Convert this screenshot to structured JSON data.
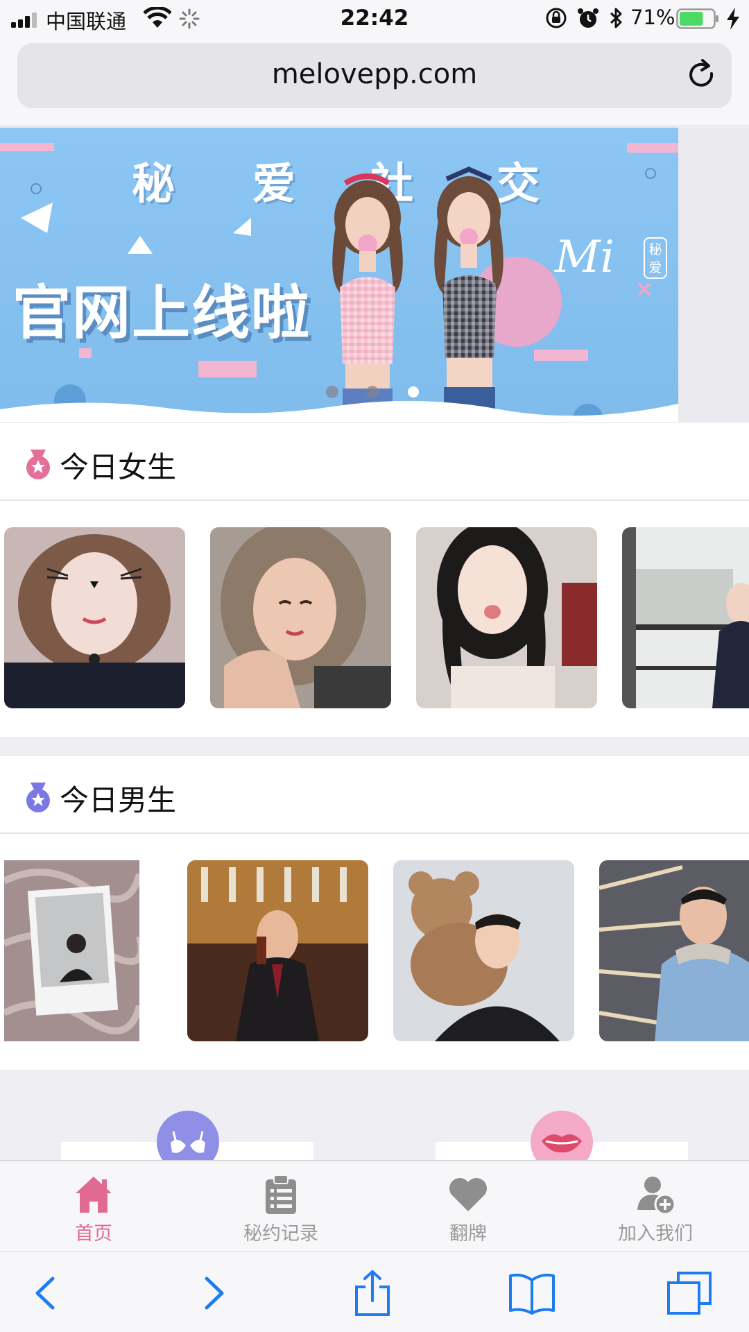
{
  "status_bar": {
    "carrier": "中国联通",
    "time": "22:42",
    "battery_percent": "71%",
    "battery_level": 0.71
  },
  "browser": {
    "url": "melovepp.com"
  },
  "banner": {
    "tagline_chars": [
      "秘",
      "爱",
      "社",
      "交"
    ],
    "headline": "官网上线啦",
    "logo_text": "Mi",
    "logo_tag": "秘爱",
    "slide_count": 3,
    "active_slide": 3
  },
  "sections": {
    "girls": {
      "title": "今日女生",
      "medal_color": "#e4709a"
    },
    "boys": {
      "title": "今日男生",
      "medal_color": "#7b78e6"
    }
  },
  "tabbar": {
    "items": [
      {
        "label": "首页",
        "icon": "home-icon",
        "active": true
      },
      {
        "label": "秘约记录",
        "icon": "clipboard-icon",
        "active": false
      },
      {
        "label": "翻牌",
        "icon": "heart-icon",
        "active": false
      },
      {
        "label": "加入我们",
        "icon": "add-user-icon",
        "active": false
      }
    ]
  },
  "colors": {
    "accent": "#e06a92",
    "inactive": "#9b9b9b",
    "banner_blue": "#8dc6f3",
    "ios_blue": "#1e7cf2"
  }
}
